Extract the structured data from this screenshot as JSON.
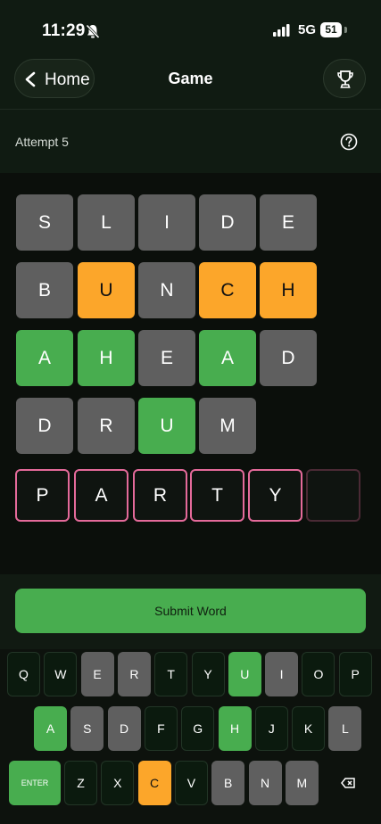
{
  "status": {
    "time": "11:29",
    "network": "5G",
    "battery": "51"
  },
  "header": {
    "back_label": "Home",
    "title": "Game"
  },
  "attempt": {
    "label": "Attempt 5"
  },
  "board": {
    "rows": [
      [
        {
          "letter": "S",
          "state": "gray"
        },
        {
          "letter": "L",
          "state": "gray"
        },
        {
          "letter": "I",
          "state": "gray"
        },
        {
          "letter": "D",
          "state": "gray"
        },
        {
          "letter": "E",
          "state": "gray"
        }
      ],
      [
        {
          "letter": "B",
          "state": "gray"
        },
        {
          "letter": "U",
          "state": "orange"
        },
        {
          "letter": "N",
          "state": "gray"
        },
        {
          "letter": "C",
          "state": "orange"
        },
        {
          "letter": "H",
          "state": "orange"
        }
      ],
      [
        {
          "letter": "A",
          "state": "green"
        },
        {
          "letter": "H",
          "state": "green"
        },
        {
          "letter": "E",
          "state": "gray"
        },
        {
          "letter": "A",
          "state": "green"
        },
        {
          "letter": "D",
          "state": "gray"
        }
      ],
      [
        {
          "letter": "D",
          "state": "gray"
        },
        {
          "letter": "R",
          "state": "gray"
        },
        {
          "letter": "U",
          "state": "green"
        },
        {
          "letter": "M",
          "state": "gray"
        }
      ],
      [
        {
          "letter": "P",
          "state": "input"
        },
        {
          "letter": "A",
          "state": "input"
        },
        {
          "letter": "R",
          "state": "input"
        },
        {
          "letter": "T",
          "state": "input"
        },
        {
          "letter": "Y",
          "state": "input"
        },
        {
          "letter": "",
          "state": "empty"
        }
      ]
    ]
  },
  "submit": {
    "label": "Submit Word"
  },
  "keyboard": {
    "rows": [
      [
        {
          "label": "Q",
          "state": "default"
        },
        {
          "label": "W",
          "state": "default"
        },
        {
          "label": "E",
          "state": "gray"
        },
        {
          "label": "R",
          "state": "gray"
        },
        {
          "label": "T",
          "state": "default"
        },
        {
          "label": "Y",
          "state": "default"
        },
        {
          "label": "U",
          "state": "green"
        },
        {
          "label": "I",
          "state": "gray"
        },
        {
          "label": "O",
          "state": "default"
        },
        {
          "label": "P",
          "state": "default"
        }
      ],
      [
        {
          "label": "A",
          "state": "green"
        },
        {
          "label": "S",
          "state": "gray"
        },
        {
          "label": "D",
          "state": "gray"
        },
        {
          "label": "F",
          "state": "default"
        },
        {
          "label": "G",
          "state": "default"
        },
        {
          "label": "H",
          "state": "green"
        },
        {
          "label": "J",
          "state": "default"
        },
        {
          "label": "K",
          "state": "default"
        },
        {
          "label": "L",
          "state": "gray"
        }
      ],
      [
        {
          "label": "ENTER",
          "state": "enter"
        },
        {
          "label": "Z",
          "state": "default"
        },
        {
          "label": "X",
          "state": "default"
        },
        {
          "label": "C",
          "state": "orange"
        },
        {
          "label": "V",
          "state": "default"
        },
        {
          "label": "B",
          "state": "gray"
        },
        {
          "label": "N",
          "state": "gray"
        },
        {
          "label": "M",
          "state": "gray"
        },
        {
          "label": "",
          "state": "backspace",
          "icon": "backspace-icon"
        }
      ]
    ]
  },
  "colors": {
    "gray": "#5f5f5f",
    "orange": "#fca62a",
    "green": "#48ad4f",
    "pink": "#ee6795",
    "background": "#0d110d"
  }
}
